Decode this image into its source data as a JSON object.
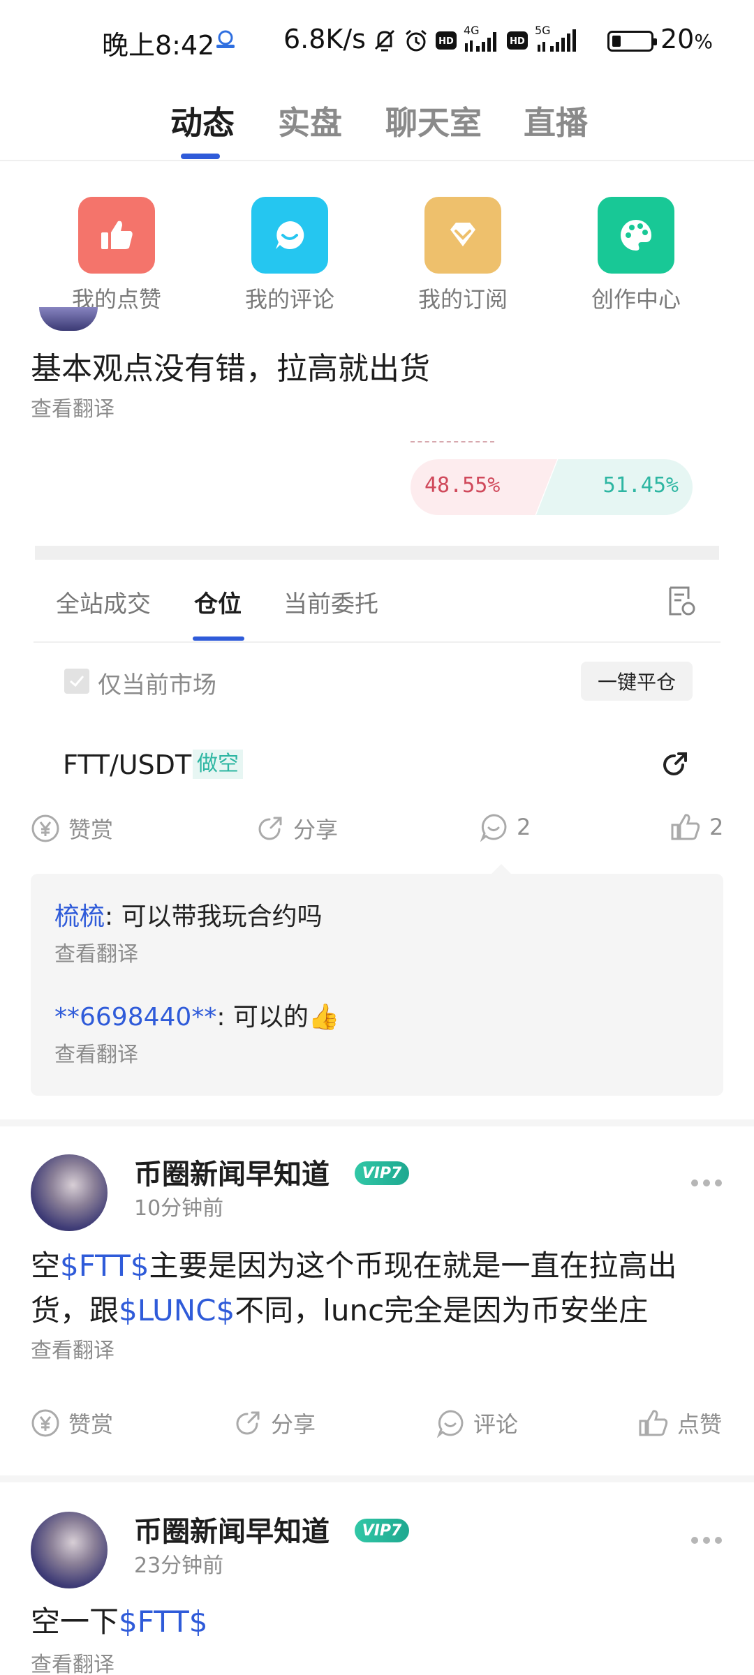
{
  "status_bar": {
    "time": "晚上8:42",
    "speed": "6.8K/s",
    "network1": "4G",
    "network2": "5G",
    "battery_percent": "20",
    "battery_unit": "%",
    "battery_level": 0.2
  },
  "top_tabs": [
    {
      "label": "动态",
      "active": true
    },
    {
      "label": "实盘",
      "active": false
    },
    {
      "label": "聊天室",
      "active": false
    },
    {
      "label": "直播",
      "active": false
    }
  ],
  "quick_tiles": [
    {
      "label": "我的点赞",
      "icon": "thumbs-up-icon",
      "color": "#f4746b"
    },
    {
      "label": "我的评论",
      "icon": "comment-icon",
      "color": "#25c6f0"
    },
    {
      "label": "我的订阅",
      "icon": "diamond-icon",
      "color": "#eec06c"
    },
    {
      "label": "创作中心",
      "icon": "palette-icon",
      "color": "#18c896"
    }
  ],
  "post1": {
    "text": "基本观点没有错，拉高就出货",
    "translate": "查看翻译",
    "long_ratio": "48.55%",
    "short_ratio": "51.45%",
    "long_color": "#d0495b",
    "short_color": "#2db6a2",
    "embed": {
      "tabs": [
        {
          "label": "全站成交",
          "active": false
        },
        {
          "label": "仓位",
          "active": true
        },
        {
          "label": "当前委托",
          "active": false
        }
      ],
      "only_current_market": "仅当前市场",
      "close_all": "一键平仓",
      "pair": "FTT/USDT",
      "side": "做空"
    },
    "actions": {
      "reward": "赞赏",
      "share": "分享",
      "comment_count": "2",
      "like_count": "2"
    },
    "comments": [
      {
        "user": "梳梳",
        "sep": ": ",
        "text": "可以带我玩合约吗",
        "translate": "查看翻译"
      },
      {
        "user": "**6698440**",
        "sep": ": ",
        "text": "可以的👍",
        "translate": "查看翻译"
      }
    ]
  },
  "post2": {
    "author": "币圈新闻早知道",
    "vip": "VIP7",
    "time": "10分钟前",
    "body_prefix": "空",
    "tag1": "$FTT$",
    "body_mid": "主要是因为这个币现在就是一直在拉高出货，跟",
    "tag2": "$LUNC$",
    "body_suffix": "不同，lunc完全是因为币安坐庄",
    "translate": "查看翻译",
    "actions": {
      "reward": "赞赏",
      "share": "分享",
      "comment": "评论",
      "like": "点赞"
    }
  },
  "post3": {
    "author": "币圈新闻早知道",
    "vip": "VIP7",
    "time": "23分钟前",
    "body_prefix": "空一下",
    "tag1": "$FTT$",
    "translate": "查看翻译"
  },
  "brand": {
    "accent": "#2f5bd9",
    "tag_blue": "#2f5bd9",
    "vip_green": "#2db6a2"
  }
}
